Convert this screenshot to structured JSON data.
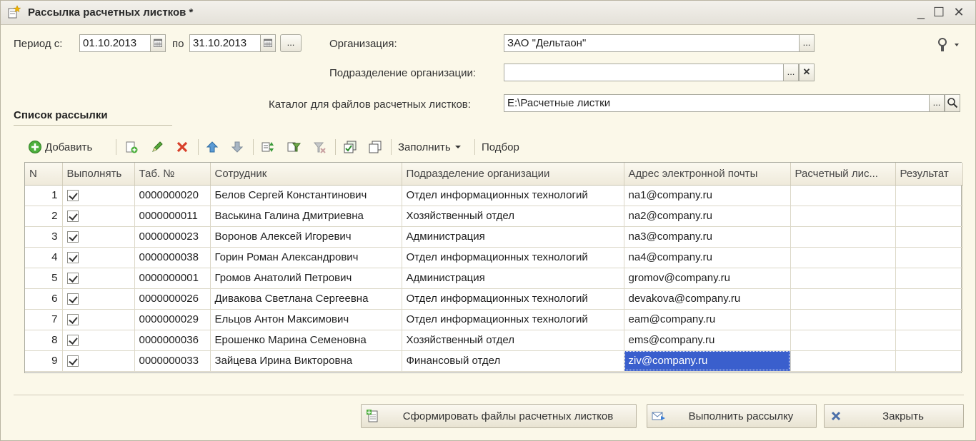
{
  "window": {
    "title": "Рассылка расчетных листков *",
    "controls": {
      "minimize": "_",
      "maximize": "☐",
      "close": "✕"
    }
  },
  "filters": {
    "period_label": "Период с:",
    "date_from": "01.10.2013",
    "to_label": "по",
    "date_to": "31.10.2013",
    "ellipsis": "...",
    "organization_label": "Организация:",
    "organization_value": "ЗАО \"Дельтаон\"",
    "department_label": "Подразделение организации:",
    "department_value": "",
    "clear_glyph": "✕",
    "catalog_label": "Каталог для файлов расчетных листков:",
    "catalog_value": "E:\\Расчетные листки"
  },
  "section_title": "Список рассылки",
  "toolbar": {
    "add_label": "Добавить",
    "fill_label": "Заполнить",
    "pick_label": "Подбор"
  },
  "table": {
    "columns": [
      "N",
      "Выполнять",
      "Таб. №",
      "Сотрудник",
      "Подразделение организации",
      "Адрес электронной почты",
      "Расчетный лис...",
      "Результат"
    ],
    "rows": [
      {
        "n": "1",
        "tab": "0000000020",
        "name": "Белов Сергей Константинович",
        "dept": "Отдел информационных технологий",
        "email": "na1@company.ru",
        "sheet": "",
        "result": ""
      },
      {
        "n": "2",
        "tab": "0000000011",
        "name": "Васькина Галина Дмитриевна",
        "dept": "Хозяйственный отдел",
        "email": "na2@company.ru",
        "sheet": "",
        "result": ""
      },
      {
        "n": "3",
        "tab": "0000000023",
        "name": "Воронов Алексей Игоревич",
        "dept": "Администрация",
        "email": "na3@company.ru",
        "sheet": "",
        "result": ""
      },
      {
        "n": "4",
        "tab": "0000000038",
        "name": "Горин Роман Александрович",
        "dept": "Отдел информационных технологий",
        "email": "na4@company.ru",
        "sheet": "",
        "result": ""
      },
      {
        "n": "5",
        "tab": "0000000001",
        "name": "Громов Анатолий Петрович",
        "dept": "Администрация",
        "email": "gromov@company.ru",
        "sheet": "",
        "result": ""
      },
      {
        "n": "6",
        "tab": "0000000026",
        "name": "Дивакова Светлана Сергеевна",
        "dept": "Отдел информационных технологий",
        "email": "devakova@company.ru",
        "sheet": "",
        "result": ""
      },
      {
        "n": "7",
        "tab": "0000000029",
        "name": "Ельцов Антон Максимович",
        "dept": "Отдел информационных технологий",
        "email": "eam@company.ru",
        "sheet": "",
        "result": ""
      },
      {
        "n": "8",
        "tab": "0000000036",
        "name": "Ерошенко Марина Семеновна",
        "dept": "Хозяйственный отдел",
        "email": "ems@company.ru",
        "sheet": "",
        "result": ""
      },
      {
        "n": "9",
        "tab": "0000000033",
        "name": "Зайцева Ирина Викторовна",
        "dept": "Финансовый отдел",
        "email": "ziv@company.ru",
        "sheet": "",
        "result": ""
      }
    ]
  },
  "buttons": {
    "generate": "Сформировать файлы расчетных листков",
    "send": "Выполнить рассылку",
    "close": "Закрыть"
  },
  "colors": {
    "background": "#fbf8e9",
    "selection": "#3a5fcd"
  }
}
